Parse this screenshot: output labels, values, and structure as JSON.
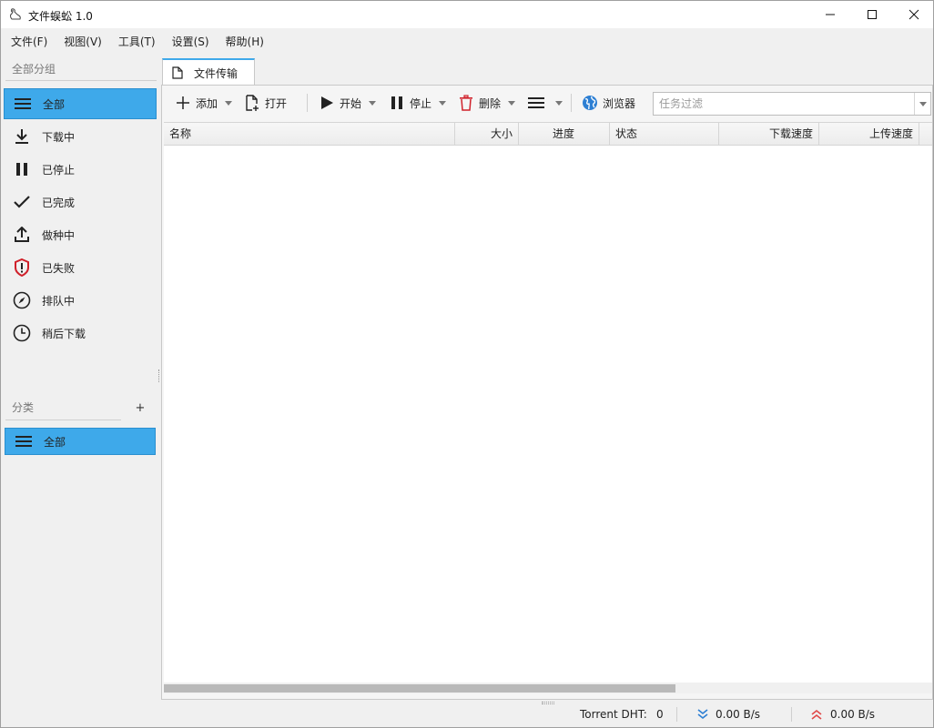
{
  "window": {
    "title": "文件蜈蚣 1.0"
  },
  "menu": [
    {
      "label": "文件(F)"
    },
    {
      "label": "视图(V)"
    },
    {
      "label": "工具(T)"
    },
    {
      "label": "设置(S)"
    },
    {
      "label": "帮助(H)"
    }
  ],
  "sidebar": {
    "group_title": "全部分组",
    "items": [
      {
        "label": "全部",
        "icon": "list-icon",
        "active": true
      },
      {
        "label": "下载中",
        "icon": "download-icon"
      },
      {
        "label": "已停止",
        "icon": "pause-icon"
      },
      {
        "label": "已完成",
        "icon": "check-icon"
      },
      {
        "label": "做种中",
        "icon": "upload-icon"
      },
      {
        "label": "已失败",
        "icon": "alert-shield-icon",
        "color": "#d0202a"
      },
      {
        "label": "排队中",
        "icon": "compass-icon"
      },
      {
        "label": "稍后下载",
        "icon": "clock-icon"
      }
    ],
    "category_title": "分类",
    "add_label": "+",
    "categories": [
      {
        "label": "全部",
        "icon": "list-icon",
        "active": true
      }
    ]
  },
  "tabs": [
    {
      "label": "文件传输",
      "icon": "file-icon",
      "active": true
    }
  ],
  "toolbar": {
    "add": "添加",
    "open": "打开",
    "start": "开始",
    "stop": "停止",
    "delete": "删除",
    "browser": "浏览器",
    "filter_placeholder": "任务过滤",
    "filter_value": ""
  },
  "table": {
    "columns": [
      "名称",
      "大小",
      "进度",
      "状态",
      "下载速度",
      "上传速度"
    ],
    "rows": []
  },
  "status": {
    "dht_label": "Torrent DHT:",
    "dht_value": "0",
    "down_speed": "0.00 B/s",
    "up_speed": "0.00 B/s"
  },
  "colors": {
    "accent": "#3ea9ea",
    "danger": "#d0202a",
    "down": "#2d7fd3",
    "up": "#e04848"
  }
}
